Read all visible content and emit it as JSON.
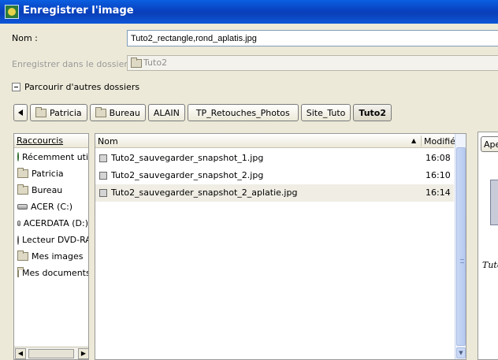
{
  "window": {
    "title": "Enregistrer l'image"
  },
  "name_field": {
    "label": "Nom :",
    "value": "Tuto2_rectangle,rond_aplatis.jpg"
  },
  "save_in_folder": {
    "label": "Enregistrer dans le dossier :",
    "value": "Tuto2"
  },
  "browse_other": {
    "label": "Parcourir d'autres dossiers"
  },
  "path_bar": [
    "Patricia",
    "Bureau",
    "ALAIN",
    "TP_Retouches_Photos",
    "Site_Tuto",
    "Tuto2"
  ],
  "places": {
    "header": "Raccourcis",
    "items": [
      {
        "label": "Récemment utili",
        "icon": "recent-icon"
      },
      {
        "label": "Patricia",
        "icon": "folder-icon"
      },
      {
        "label": "Bureau",
        "icon": "folder-icon"
      },
      {
        "label": "ACER (C:)",
        "icon": "drive-icon"
      },
      {
        "label": "ACERDATA (D:)",
        "icon": "drive-icon"
      },
      {
        "label": "Lecteur DVD-RA",
        "icon": "dvd-icon"
      },
      {
        "label": "Mes images",
        "icon": "folder-icon"
      },
      {
        "label": "Mes documents",
        "icon": "folder-icon"
      }
    ]
  },
  "files": {
    "columns": {
      "name": "Nom",
      "modified": "Modifié"
    },
    "rows": [
      {
        "name": "Tuto2_sauvegarder_snapshot_1.jpg",
        "modified": "16:08"
      },
      {
        "name": "Tuto2_sauvegarder_snapshot_2.jpg",
        "modified": "16:10"
      },
      {
        "name": "Tuto2_sauvegarder_snapshot_2_aplatie.jpg",
        "modified": "16:14"
      }
    ]
  },
  "preview": {
    "button": "Aperçu",
    "caption": "Tuto"
  }
}
